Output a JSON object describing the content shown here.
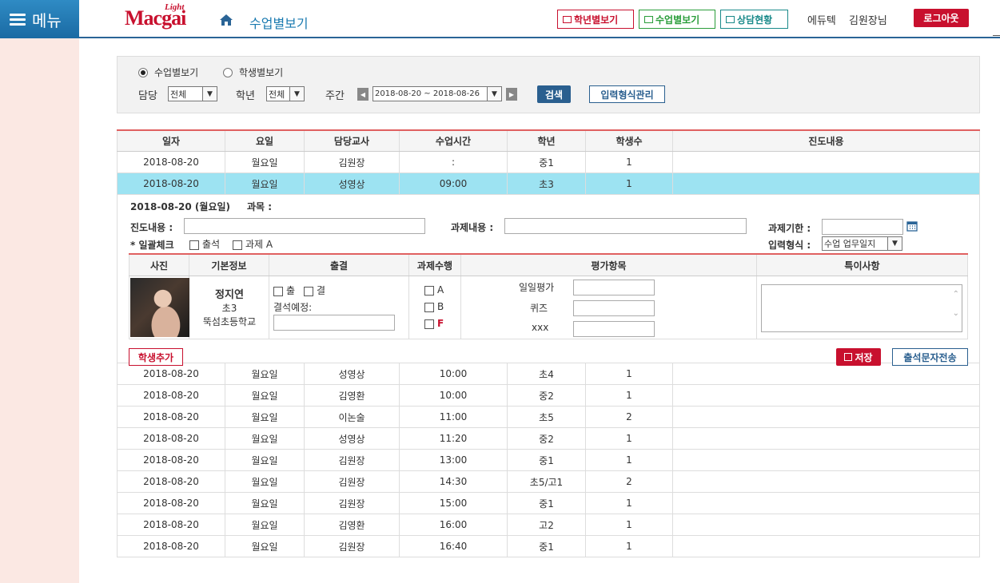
{
  "header": {
    "menu_label": "메뉴",
    "logo_text": "Macgai",
    "logo_light": "Light",
    "page_title": "수업별보기",
    "btn_grade": "학년별보기",
    "btn_class": "수업별보기",
    "btn_consult": "상담현황",
    "academy": "에듀텍",
    "user": "김원장님",
    "logout": "로그아웃"
  },
  "filter": {
    "radio_class": "수업별보기",
    "radio_student": "학생별보기",
    "teacher_label": "담당",
    "teacher_value": "전체",
    "grade_label": "학년",
    "grade_value": "전체",
    "week_label": "주간",
    "week_value": "2018-08-20 ~ 2018-08-26",
    "search": "검색",
    "format_manage": "입력형식관리"
  },
  "table": {
    "headers": [
      "일자",
      "요일",
      "담당교사",
      "수업시간",
      "학년",
      "학생수",
      "진도내용"
    ],
    "rows_top": [
      [
        "2018-08-20",
        "월요일",
        "김원장",
        ":",
        "중1",
        "1",
        ""
      ],
      [
        "2018-08-20",
        "월요일",
        "성영상",
        "09:00",
        "초3",
        "1",
        ""
      ]
    ],
    "rows_bottom": [
      [
        "2018-08-20",
        "월요일",
        "성영상",
        "10:00",
        "초4",
        "1",
        ""
      ],
      [
        "2018-08-20",
        "월요일",
        "김영환",
        "10:00",
        "중2",
        "1",
        ""
      ],
      [
        "2018-08-20",
        "월요일",
        "이논술",
        "11:00",
        "초5",
        "2",
        ""
      ],
      [
        "2018-08-20",
        "월요일",
        "성영상",
        "11:20",
        "중2",
        "1",
        ""
      ],
      [
        "2018-08-20",
        "월요일",
        "김원장",
        "13:00",
        "중1",
        "1",
        ""
      ],
      [
        "2018-08-20",
        "월요일",
        "김원장",
        "14:30",
        "초5/고1",
        "2",
        ""
      ],
      [
        "2018-08-20",
        "월요일",
        "김원장",
        "15:00",
        "중1",
        "1",
        ""
      ],
      [
        "2018-08-20",
        "월요일",
        "김영환",
        "16:00",
        "고2",
        "1",
        ""
      ],
      [
        "2018-08-20",
        "월요일",
        "김원장",
        "16:40",
        "중1",
        "1",
        ""
      ]
    ]
  },
  "detail": {
    "date": "2018-08-20 (월요일)",
    "subject_label": "과목 :",
    "progress_label": "진도내용 :",
    "homework_label": "과제내용 :",
    "deadline_label": "과제기한 :",
    "bulk_label": "* 일괄체크",
    "bulk_attend": "출석",
    "bulk_homework": "과제 A",
    "format_label": "입력형식 :",
    "format_value": "수업 업무일지",
    "inner_headers": [
      "사진",
      "기본정보",
      "출결",
      "과제수행",
      "평가항목",
      "특이사항"
    ],
    "student": {
      "name": "정지연",
      "grade": "초3",
      "school": "뚝섬초등학교"
    },
    "attend_present": "출",
    "attend_absent": "결",
    "absence_plan": "결석예정:",
    "hw_a": "A",
    "hw_b": "B",
    "hw_f": "F",
    "eval_items": [
      "일일평가",
      "퀴즈",
      "xxx"
    ],
    "add_student": "학생추가",
    "save": "저장",
    "send_sms": "출석문자전송"
  }
}
